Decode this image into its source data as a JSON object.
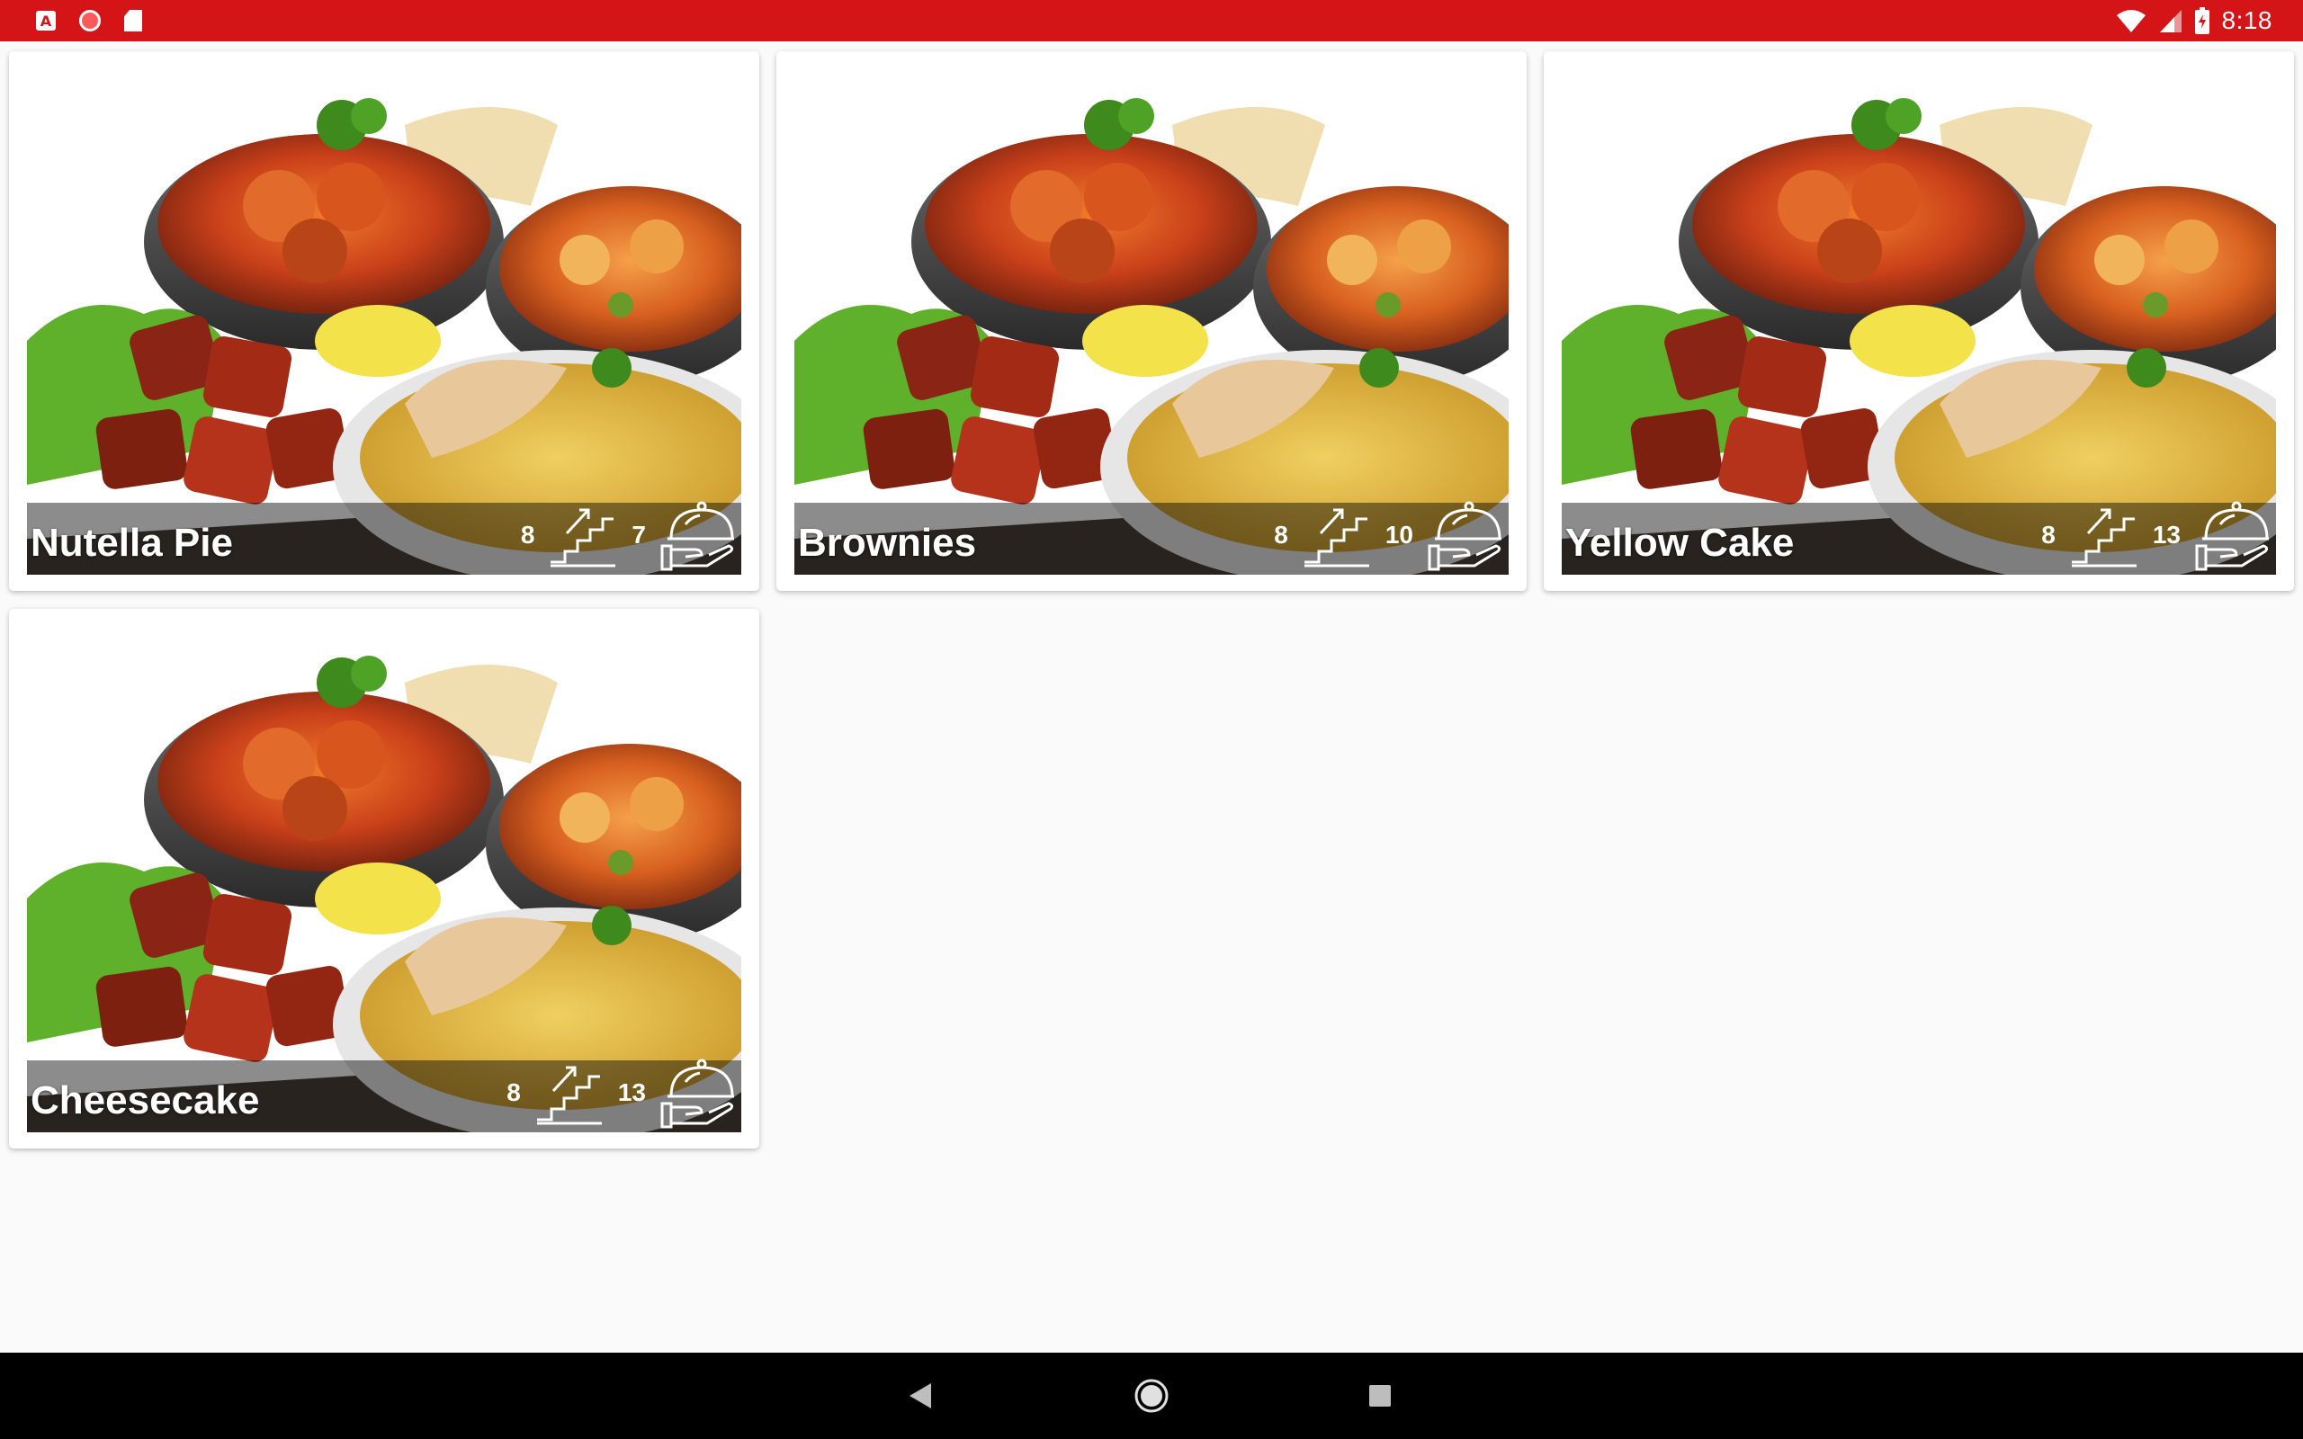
{
  "status_bar": {
    "time": "8:18",
    "left_icons": [
      "a-app-icon",
      "record-icon",
      "sd-card-icon"
    ],
    "right_icons": [
      "wifi-icon",
      "signal-icon",
      "battery-icon"
    ],
    "color": "#d51418"
  },
  "cards": [
    {
      "title": "Nutella Pie",
      "difficulty": "8",
      "servings": "7"
    },
    {
      "title": "Brownies",
      "difficulty": "8",
      "servings": "10"
    },
    {
      "title": "Yellow Cake",
      "difficulty": "8",
      "servings": "13"
    },
    {
      "title": "Cheesecake",
      "difficulty": "8",
      "servings": "13"
    }
  ],
  "nav_bar": {
    "buttons": [
      "back-icon",
      "home-icon",
      "recents-icon"
    ]
  }
}
